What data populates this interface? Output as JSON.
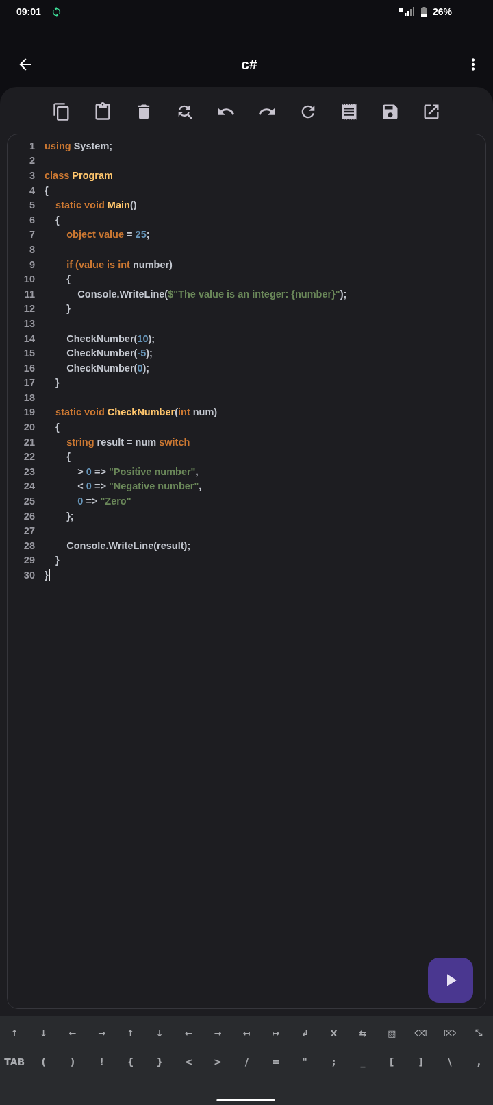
{
  "status_bar": {
    "time": "09:01",
    "battery": "26%"
  },
  "app_bar": {
    "title": "c#"
  },
  "editor": {
    "lines": [
      {
        "number": "1",
        "tokens": [
          {
            "text": "using",
            "kind": "kw"
          },
          {
            "text": " System;",
            "kind": "plain"
          }
        ]
      },
      {
        "number": "2"
      },
      {
        "number": "3",
        "tokens": [
          {
            "text": "class ",
            "kind": "kw"
          },
          {
            "text": "Program",
            "kind": "fn"
          }
        ]
      },
      {
        "number": "4",
        "tokens": [
          {
            "text": "{",
            "kind": "plain"
          }
        ]
      },
      {
        "number": "5",
        "tokens": [
          {
            "text": "    static void ",
            "kind": "kw"
          },
          {
            "text": "Main",
            "kind": "fn"
          },
          {
            "text": "()",
            "kind": "plain"
          }
        ]
      },
      {
        "number": "6",
        "tokens": [
          {
            "text": "    {",
            "kind": "plain"
          }
        ]
      },
      {
        "number": "7",
        "tokens": [
          {
            "text": "        object value",
            "kind": "kw"
          },
          {
            "text": " = ",
            "kind": "plain"
          },
          {
            "text": "25",
            "kind": "num"
          },
          {
            "text": ";",
            "kind": "plain"
          }
        ]
      },
      {
        "number": "8"
      },
      {
        "number": "9",
        "tokens": [
          {
            "text": "        if (value is int",
            "kind": "kw"
          },
          {
            "text": " number)",
            "kind": "plain"
          }
        ]
      },
      {
        "number": "10",
        "tokens": [
          {
            "text": "        {",
            "kind": "plain"
          }
        ]
      },
      {
        "number": "11",
        "tokens": [
          {
            "text": "            Console.WriteLine(",
            "kind": "plain"
          },
          {
            "text": "$\"The value is an integer: {number}\"",
            "kind": "str"
          },
          {
            "text": ");",
            "kind": "plain"
          }
        ]
      },
      {
        "number": "12",
        "tokens": [
          {
            "text": "        }",
            "kind": "plain"
          }
        ]
      },
      {
        "number": "13"
      },
      {
        "number": "14",
        "tokens": [
          {
            "text": "        CheckNumber(",
            "kind": "plain"
          },
          {
            "text": "10",
            "kind": "num"
          },
          {
            "text": ");",
            "kind": "plain"
          }
        ]
      },
      {
        "number": "15",
        "tokens": [
          {
            "text": "        CheckNumber(",
            "kind": "plain"
          },
          {
            "text": "-5",
            "kind": "num"
          },
          {
            "text": ");",
            "kind": "plain"
          }
        ]
      },
      {
        "number": "16",
        "tokens": [
          {
            "text": "        CheckNumber(",
            "kind": "plain"
          },
          {
            "text": "0",
            "kind": "num"
          },
          {
            "text": ");",
            "kind": "plain"
          }
        ]
      },
      {
        "number": "17",
        "tokens": [
          {
            "text": "    }",
            "kind": "plain"
          }
        ]
      },
      {
        "number": "18"
      },
      {
        "number": "19",
        "tokens": [
          {
            "text": "    static void ",
            "kind": "kw"
          },
          {
            "text": "CheckNumber",
            "kind": "fn"
          },
          {
            "text": "(",
            "kind": "plain"
          },
          {
            "text": "int",
            "kind": "kw"
          },
          {
            "text": " num)",
            "kind": "plain"
          }
        ]
      },
      {
        "number": "20",
        "tokens": [
          {
            "text": "    {",
            "kind": "plain"
          }
        ]
      },
      {
        "number": "21",
        "tokens": [
          {
            "text": "        string",
            "kind": "kw"
          },
          {
            "text": " result = num ",
            "kind": "plain"
          },
          {
            "text": "switch",
            "kind": "kw"
          }
        ]
      },
      {
        "number": "22",
        "tokens": [
          {
            "text": "        {",
            "kind": "plain"
          }
        ]
      },
      {
        "number": "23",
        "tokens": [
          {
            "text": "            > ",
            "kind": "plain"
          },
          {
            "text": "0",
            "kind": "num"
          },
          {
            "text": " => ",
            "kind": "plain"
          },
          {
            "text": "\"Positive number\"",
            "kind": "str"
          },
          {
            "text": ",",
            "kind": "plain"
          }
        ]
      },
      {
        "number": "24",
        "tokens": [
          {
            "text": "            < ",
            "kind": "plain"
          },
          {
            "text": "0",
            "kind": "num"
          },
          {
            "text": " => ",
            "kind": "plain"
          },
          {
            "text": "\"Negative number\"",
            "kind": "str"
          },
          {
            "text": ",",
            "kind": "plain"
          }
        ]
      },
      {
        "number": "25",
        "tokens": [
          {
            "text": "            0",
            "kind": "num"
          },
          {
            "text": " => ",
            "kind": "plain"
          },
          {
            "text": "\"Zero\"",
            "kind": "str"
          }
        ]
      },
      {
        "number": "26",
        "tokens": [
          {
            "text": "        };",
            "kind": "plain"
          }
        ]
      },
      {
        "number": "27"
      },
      {
        "number": "28",
        "tokens": [
          {
            "text": "        Console.WriteLine(result);",
            "kind": "plain"
          }
        ]
      },
      {
        "number": "29",
        "tokens": [
          {
            "text": "    }",
            "kind": "plain"
          }
        ]
      },
      {
        "number": "30",
        "tokens": [
          {
            "text": "}",
            "kind": "plain"
          }
        ]
      }
    ]
  },
  "keyboard": {
    "rows": [
      [
        "↑",
        "↓",
        "←",
        "→",
        "↑",
        "↓",
        "←",
        "→",
        "↤",
        "↦",
        "↲",
        "X",
        "⇆",
        "▧",
        "⌫",
        "⌦",
        "⤡"
      ],
      [
        "TAB",
        "(",
        ")",
        "!",
        "{",
        "}",
        "<",
        ">",
        "/",
        "=",
        "\"",
        ";",
        "_",
        "[",
        "]",
        "\\",
        ","
      ]
    ]
  }
}
